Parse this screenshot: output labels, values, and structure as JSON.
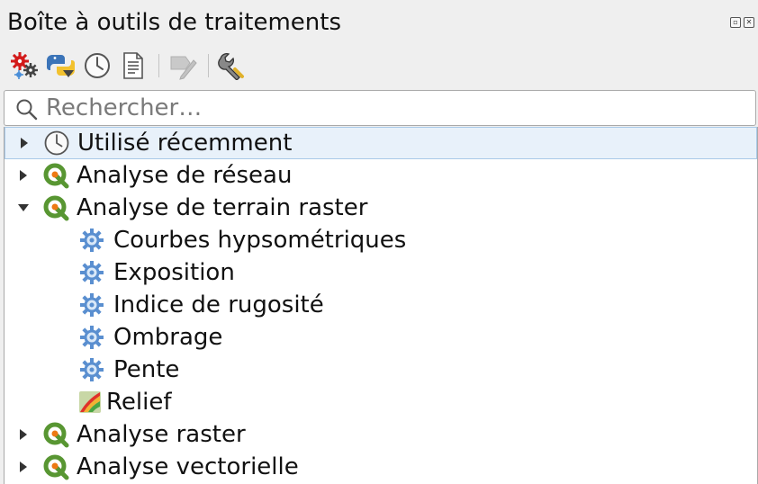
{
  "panel": {
    "title": "Boîte à outils de traitements",
    "float_icon": "float-icon",
    "close_icon": "close-icon"
  },
  "toolbar": {
    "buttons": [
      {
        "name": "models-button",
        "icon": "gears-icon",
        "enabled": true
      },
      {
        "name": "scripts-button",
        "icon": "python-icon",
        "enabled": true
      },
      {
        "name": "history-button",
        "icon": "clock-icon",
        "enabled": true
      },
      {
        "name": "results-viewer-button",
        "icon": "document-icon",
        "enabled": true
      },
      {
        "name": "edit-features-in-place-button",
        "icon": "edit-in-place-icon",
        "enabled": false
      },
      {
        "name": "options-button",
        "icon": "wrench-icon",
        "enabled": true
      }
    ]
  },
  "search": {
    "placeholder": "Rechercher…",
    "value": ""
  },
  "tree": {
    "items": [
      {
        "label": "Utilisé récemment",
        "level": 0,
        "expanded": false,
        "icon": "clock-icon",
        "selected": true
      },
      {
        "label": "Analyse de réseau",
        "level": 0,
        "expanded": false,
        "icon": "qgis-icon"
      },
      {
        "label": "Analyse de terrain raster",
        "level": 0,
        "expanded": true,
        "icon": "qgis-icon"
      },
      {
        "label": "Courbes hypsométriques",
        "level": 1,
        "icon": "algorithm-gear-icon"
      },
      {
        "label": "Exposition",
        "level": 1,
        "icon": "algorithm-gear-icon"
      },
      {
        "label": "Indice de rugosité",
        "level": 1,
        "icon": "algorithm-gear-icon"
      },
      {
        "label": "Ombrage",
        "level": 1,
        "icon": "algorithm-gear-icon"
      },
      {
        "label": "Pente",
        "level": 1,
        "icon": "algorithm-gear-icon"
      },
      {
        "label": "Relief",
        "level": 1,
        "icon": "relief-icon"
      },
      {
        "label": "Analyse raster",
        "level": 0,
        "expanded": false,
        "icon": "qgis-icon"
      },
      {
        "label": "Analyse vectorielle",
        "level": 0,
        "expanded": false,
        "icon": "qgis-icon"
      }
    ]
  }
}
